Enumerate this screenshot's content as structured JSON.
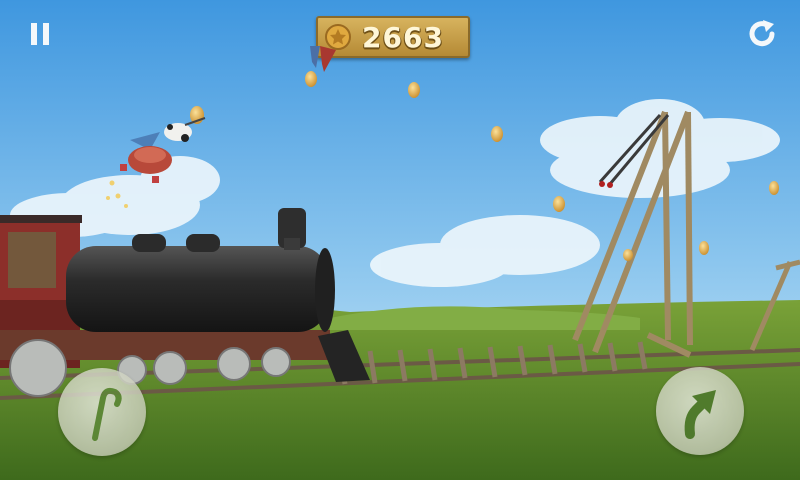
{
  "hud": {
    "score": "2663",
    "pause_icon": "pause-icon",
    "restart_icon": "restart-icon",
    "coin_icon": "coin-icon"
  },
  "controls": {
    "left_action_icon": "umbrella-handle-icon",
    "right_action_icon": "jump-arrow-icon"
  },
  "colors": {
    "sky_top": "#4a9ee0",
    "sky_bottom": "#bfe1f5",
    "grass": "#5f8d2a",
    "coin": "#e3b04b",
    "locomotive": "#2a2a2a",
    "cab_red": "#8c2f2a"
  }
}
